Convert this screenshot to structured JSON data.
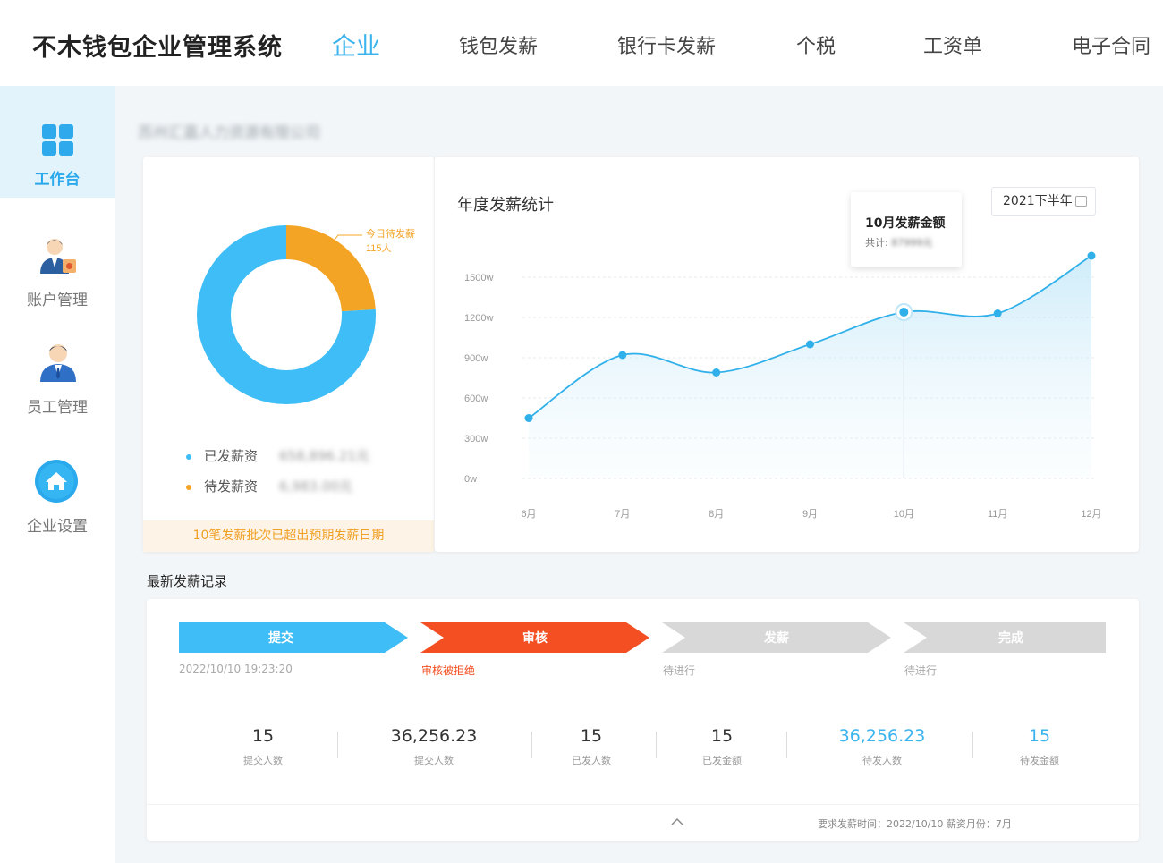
{
  "header": {
    "brand": "不木钱包企业管理系统",
    "nav": [
      {
        "label": "企业",
        "active": true
      },
      {
        "label": "钱包发薪",
        "active": false
      },
      {
        "label": "银行卡发薪",
        "active": false
      },
      {
        "label": "个税",
        "active": false
      },
      {
        "label": "工资单",
        "active": false
      },
      {
        "label": "电子合同",
        "active": false
      }
    ]
  },
  "sidebar": {
    "items": [
      {
        "label": "工作台",
        "icon": "grid-icon",
        "active": true
      },
      {
        "label": "账户管理",
        "icon": "account-user-icon",
        "active": false
      },
      {
        "label": "员工管理",
        "icon": "employee-icon",
        "active": false
      },
      {
        "label": "企业设置",
        "icon": "home-settings-icon",
        "active": false
      }
    ]
  },
  "company": {
    "name": "苏州汇嘉人力资源有限公司"
  },
  "payout_summary": {
    "donut_callout_line1": "今日待发薪",
    "donut_callout_line2": "115人",
    "paid_fraction": 0.76,
    "pending_fraction": 0.24,
    "legend": [
      {
        "label": "已发薪资",
        "value": "658,896.21元",
        "color": "#3fbdf6"
      },
      {
        "label": "待发薪资",
        "value": "6,983.00元",
        "color": "#f4a425"
      }
    ],
    "overdue_notice": "10笔发薪批次已超出预期发薪日期"
  },
  "annual_chart": {
    "title": "年度发薪统计",
    "period_selector": "2021下半年",
    "tooltip_title": "10月发薪金额",
    "tooltip_label": "共计:",
    "tooltip_value": "87999元"
  },
  "chart_data": {
    "type": "area",
    "title": "年度发薪统计",
    "categories": [
      "6月",
      "7月",
      "8月",
      "9月",
      "10月",
      "11月",
      "12月"
    ],
    "values": [
      450,
      920,
      790,
      1000,
      1240,
      1230,
      1660
    ],
    "yticks": [
      "1500w",
      "1200w",
      "900w",
      "600w",
      "300w",
      "0w"
    ],
    "ylim": [
      0,
      1500
    ],
    "unit": "w",
    "highlight_index": 4,
    "color": "#2fb0ea",
    "grid": true
  },
  "records": {
    "title": "最新发薪记录",
    "steps": [
      {
        "label": "提交",
        "sub": "2022/10/10 19:23:20",
        "color": "#3fbdf6",
        "sub_color": "#aaaaaa"
      },
      {
        "label": "审核",
        "sub": "审核被拒绝",
        "color": "#f44f22",
        "sub_color": "#f44f22"
      },
      {
        "label": "发薪",
        "sub": "待进行",
        "color": "#d8d8d8",
        "sub_color": "#aaaaaa"
      },
      {
        "label": "完成",
        "sub": "待进行",
        "color": "#d8d8d8",
        "sub_color": "#aaaaaa"
      }
    ],
    "stats": [
      {
        "value": "15",
        "label": "提交人数",
        "highlight": false
      },
      {
        "value": "36,256.23",
        "label": "提交人数",
        "highlight": false
      },
      {
        "value": "15",
        "label": "已发人数",
        "highlight": false
      },
      {
        "value": "15",
        "label": "已发金额",
        "highlight": false
      },
      {
        "value": "36,256.23",
        "label": "待发人数",
        "highlight": true
      },
      {
        "value": "15",
        "label": "待发金额",
        "highlight": true
      }
    ],
    "footer": "要求发薪时间：2022/10/10    薪资月份：7月"
  }
}
